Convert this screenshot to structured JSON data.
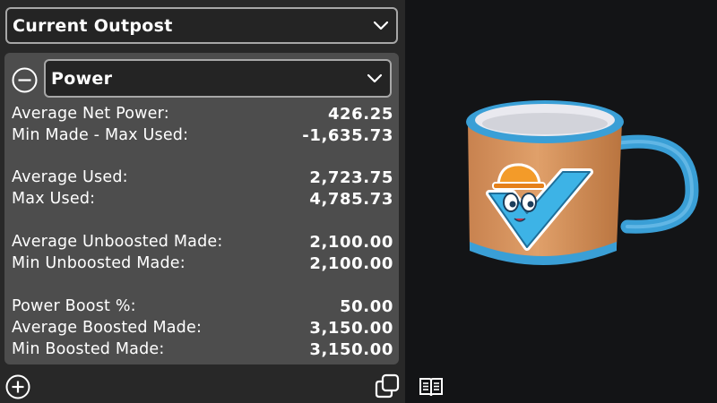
{
  "outpost_select": {
    "value": "Current Outpost"
  },
  "category_select": {
    "value": "Power"
  },
  "stats": [
    {
      "label": "Average Net Power:",
      "value": "426.25"
    },
    {
      "label": "Min Made - Max Used:",
      "value": "-1,635.73"
    },
    {
      "label": "Average Used:",
      "value": "2,723.75"
    },
    {
      "label": "Max Used:",
      "value": "4,785.73"
    },
    {
      "label": "Average Unboosted Made:",
      "value": "2,100.00"
    },
    {
      "label": "Min Unboosted Made:",
      "value": "2,100.00"
    },
    {
      "label": "Power Boost %:",
      "value": "50.00"
    },
    {
      "label": "Average Boosted Made:",
      "value": "3,150.00"
    },
    {
      "label": "Min Boosted Made:",
      "value": "3,150.00"
    }
  ],
  "icons": {
    "dropdown": "chevron-down-icon",
    "collapse": "minus-circle-icon",
    "add": "plus-circle-icon",
    "copy": "copy-icon",
    "book": "book-icon"
  },
  "colors": {
    "panel": "#282828",
    "card": "#4d4d4d",
    "dropdown_bg": "#242424",
    "dropdown_border": "#a7a7a7",
    "background": "#131416",
    "mug_body": "#d9955f",
    "mug_rim": "#3aa3d8"
  }
}
